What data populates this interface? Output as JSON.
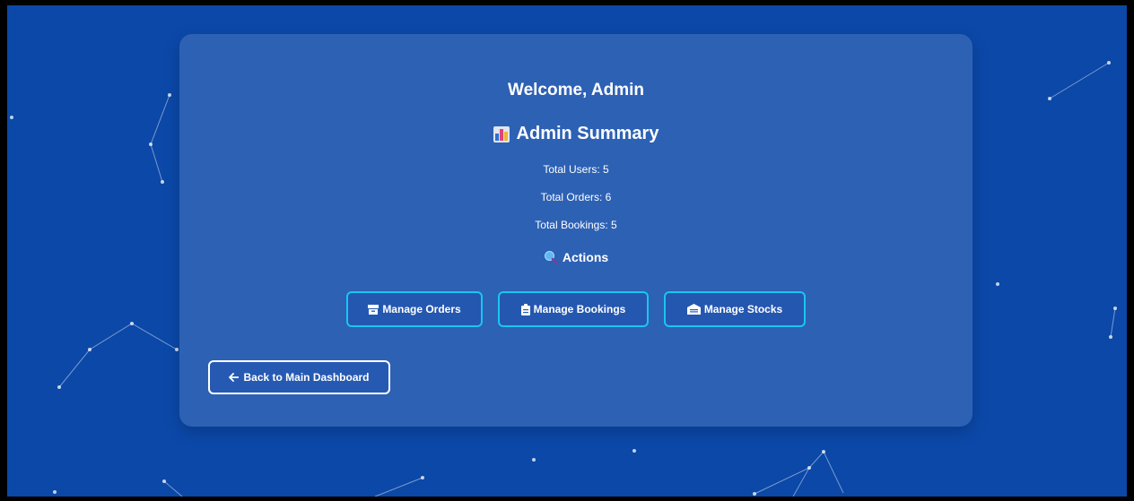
{
  "welcome": "Welcome, Admin",
  "summary": {
    "title": "Admin Summary",
    "icon": "bar-chart-icon",
    "stats": [
      {
        "label": "Total Users: 5"
      },
      {
        "label": "Total Orders: 6"
      },
      {
        "label": "Total Bookings: 5"
      }
    ]
  },
  "actions": {
    "title": "Actions",
    "icon": "magnifier-icon",
    "buttons": [
      {
        "label": "Manage Orders",
        "icon": "box-icon"
      },
      {
        "label": "Manage Bookings",
        "icon": "clipboard-icon"
      },
      {
        "label": "Manage Stocks",
        "icon": "warehouse-icon"
      }
    ]
  },
  "back": {
    "label": "Back to Main Dashboard",
    "icon": "arrow-left-icon"
  },
  "colors": {
    "background": "#0b48a8",
    "button_border": "#19c6ef",
    "text": "#ffffff"
  }
}
